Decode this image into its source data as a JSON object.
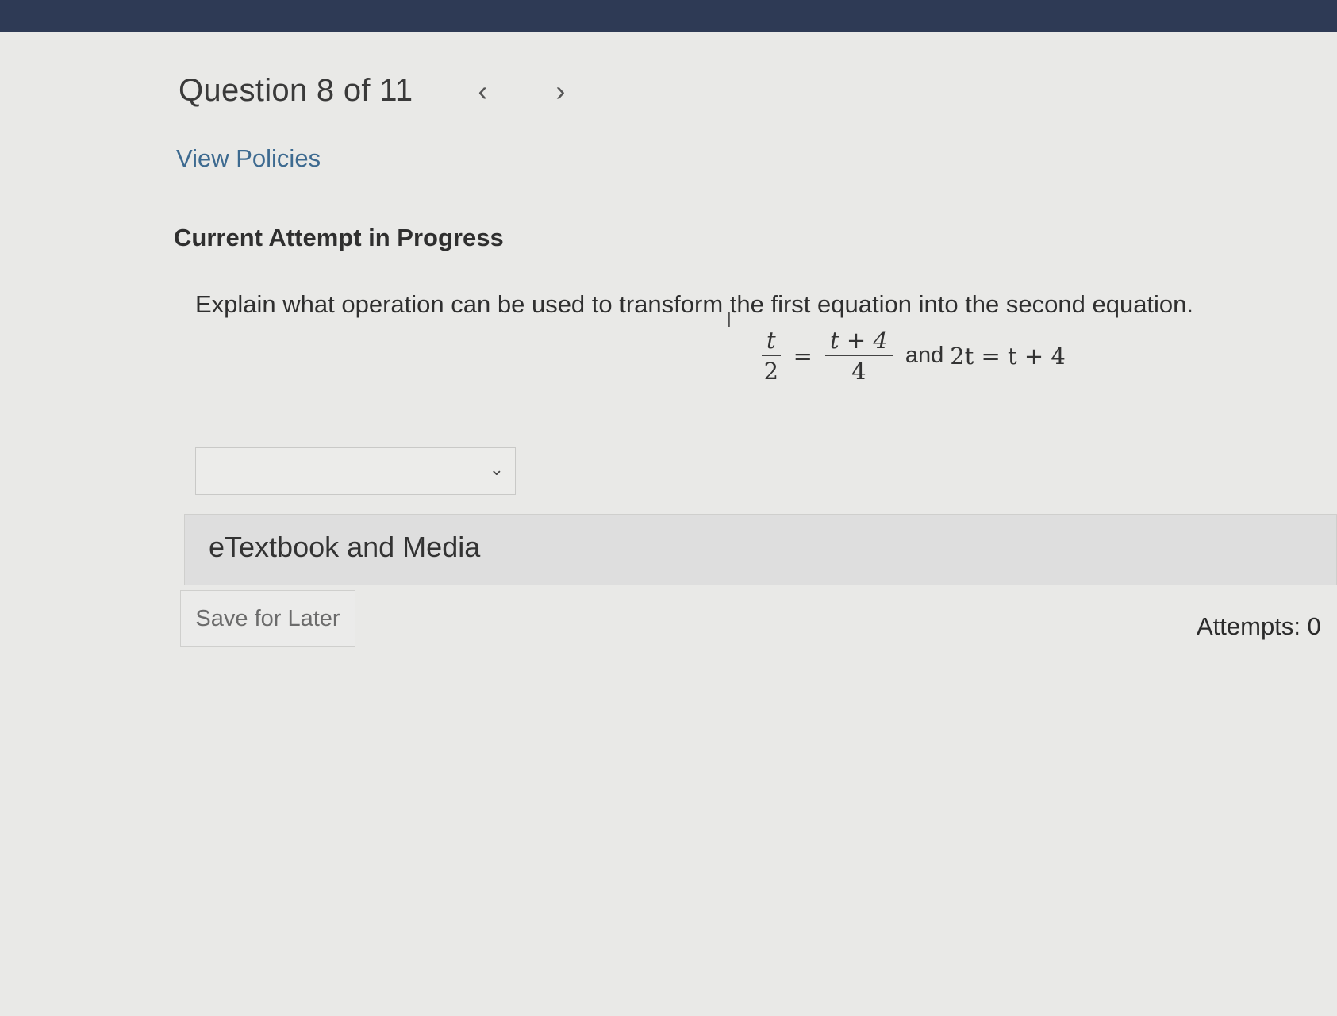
{
  "header": {
    "title": "Question 8 of 11",
    "prev_icon": "chevron-left-icon",
    "prev_glyph": "‹",
    "next_icon": "chevron-right-icon",
    "next_glyph": "›",
    "view_policies": "View Policies"
  },
  "attempt_heading": "Current Attempt in Progress",
  "question": {
    "text": "Explain what operation can be used to transform the first equation into the second equation.",
    "equation": {
      "frac1_num": "t",
      "frac1_den": "2",
      "equals1": "=",
      "frac2_num": "t + 4",
      "frac2_den": "4",
      "connector": "and",
      "rhs": "2t = t + 4"
    }
  },
  "answer_dropdown": {
    "selected": "",
    "icon": "chevron-down-icon",
    "glyph": "⌄"
  },
  "etextbook": {
    "label": "eTextbook and Media"
  },
  "footer": {
    "save_label": "Save for Later",
    "attempts_text": "Attempts: 0"
  },
  "colors": {
    "topbar": "#2e3a55",
    "link": "#3d6a90",
    "page_bg": "#e9e9e7"
  }
}
